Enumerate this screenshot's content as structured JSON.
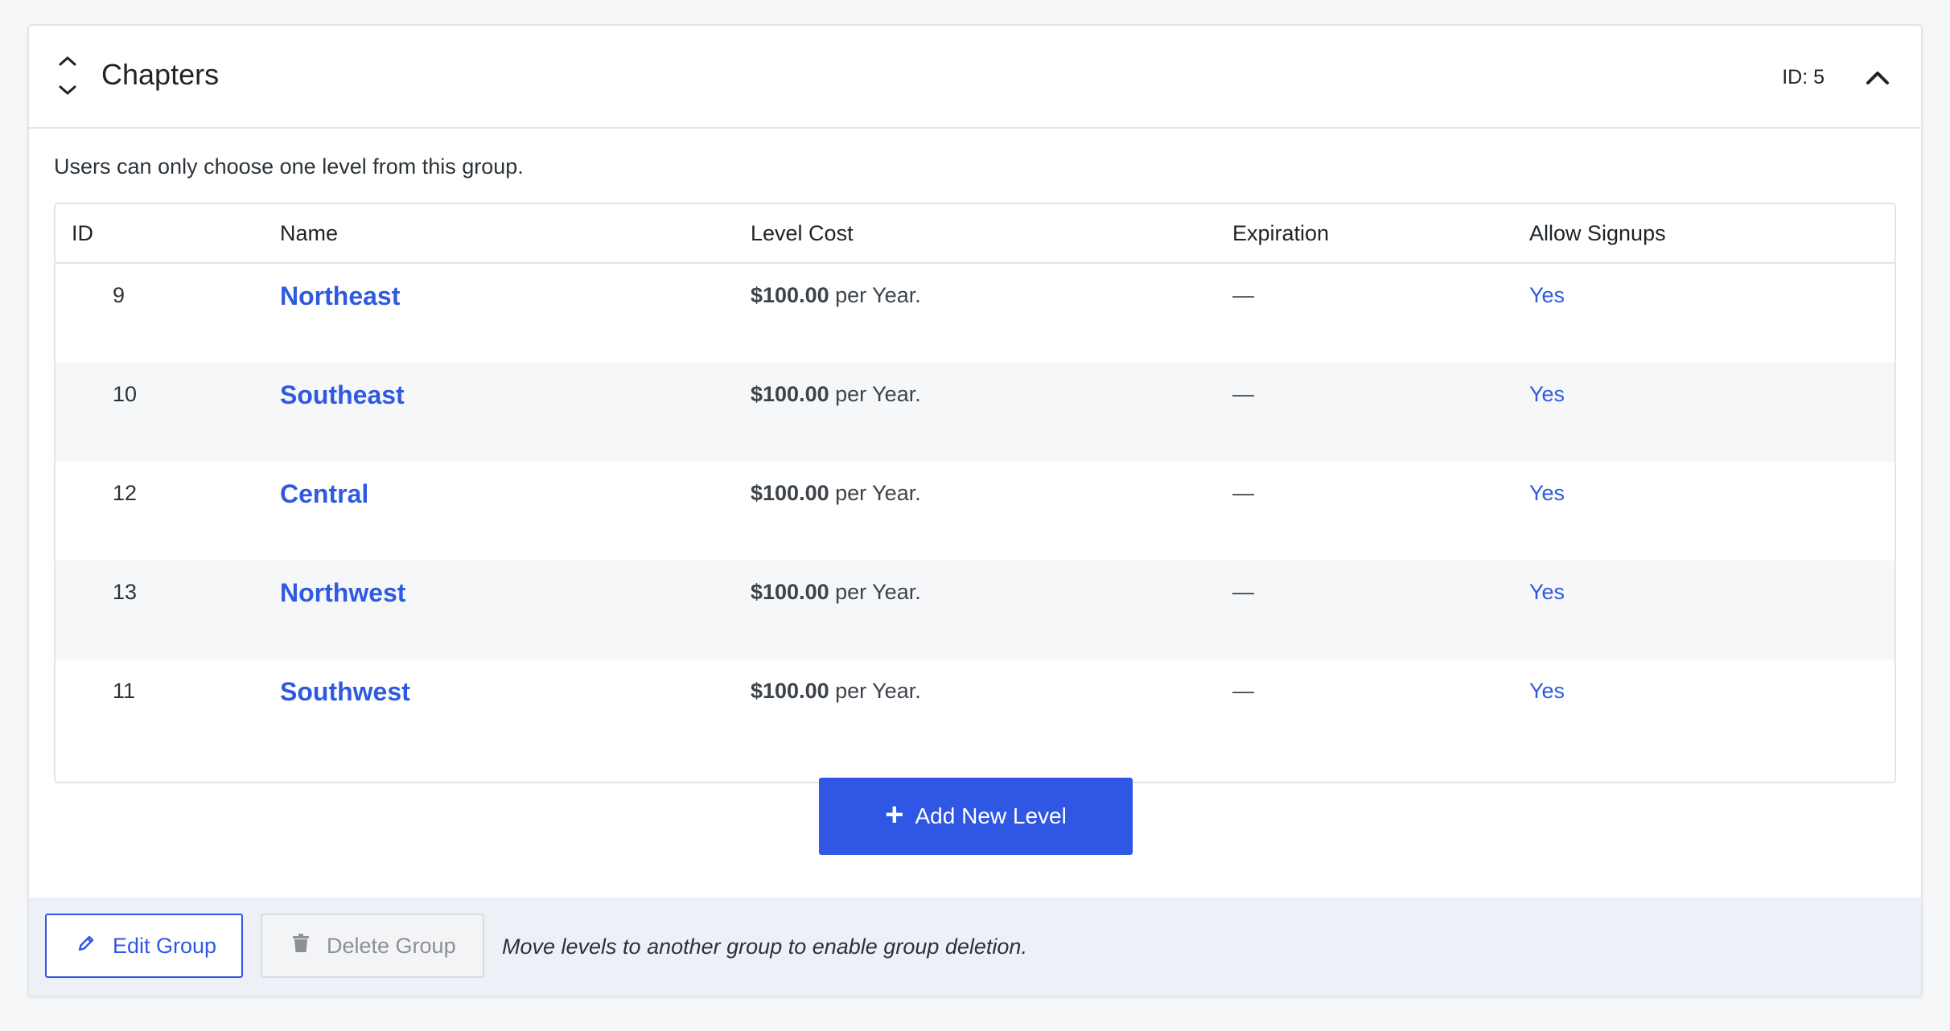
{
  "group": {
    "title": "Chapters",
    "id_label": "ID: 5",
    "description": "Users can only choose one level from this group."
  },
  "table": {
    "columns": [
      "ID",
      "Name",
      "Level Cost",
      "Expiration",
      "Allow Signups"
    ],
    "rows": [
      {
        "id": "9",
        "name": "Northeast",
        "cost_amount": "$100.00",
        "cost_period": " per Year.",
        "expiration": "—",
        "allow_signups": "Yes"
      },
      {
        "id": "10",
        "name": "Southeast",
        "cost_amount": "$100.00",
        "cost_period": " per Year.",
        "expiration": "—",
        "allow_signups": "Yes"
      },
      {
        "id": "12",
        "name": "Central",
        "cost_amount": "$100.00",
        "cost_period": " per Year.",
        "expiration": "—",
        "allow_signups": "Yes"
      },
      {
        "id": "13",
        "name": "Northwest",
        "cost_amount": "$100.00",
        "cost_period": " per Year.",
        "expiration": "—",
        "allow_signups": "Yes"
      },
      {
        "id": "11",
        "name": "Southwest",
        "cost_amount": "$100.00",
        "cost_period": " per Year.",
        "expiration": "—",
        "allow_signups": "Yes"
      }
    ]
  },
  "actions": {
    "add_level": "Add New Level",
    "edit_group": "Edit Group",
    "delete_group": "Delete Group",
    "delete_note": "Move levels to another group to enable group deletion."
  },
  "icons": {
    "sort": "sort-up-down-icon",
    "collapse": "chevron-up-icon",
    "add": "plus-icon",
    "edit": "pencil-icon",
    "delete": "trash-icon"
  },
  "colors": {
    "accent": "#2f57e4",
    "link": "#2f5ae0",
    "footer_bg": "#edf0f6",
    "row_alt": "#f6f7f9"
  }
}
